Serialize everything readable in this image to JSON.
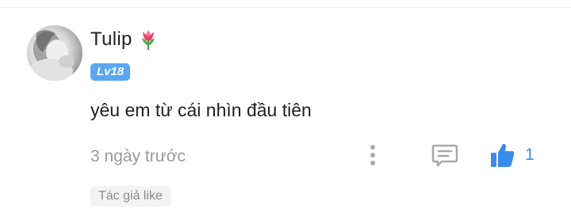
{
  "comment": {
    "username": "Tulip",
    "username_emoji_icon": "tulip-icon",
    "level_badge": "Lv18",
    "text": "yêu em từ cái nhìn đầu tiên",
    "timestamp": "3 ngày trước",
    "like_count": "1",
    "author_like_tag": "Tác giả like"
  },
  "icons": {
    "more": "more-vertical-icon",
    "reply": "comment-icon",
    "like": "thumbs-up-icon"
  },
  "colors": {
    "accent": "#3a8de6",
    "badge": "#5aa7f2",
    "muted_text": "#9a9a9a",
    "icon_gray": "#a9a9a9"
  }
}
